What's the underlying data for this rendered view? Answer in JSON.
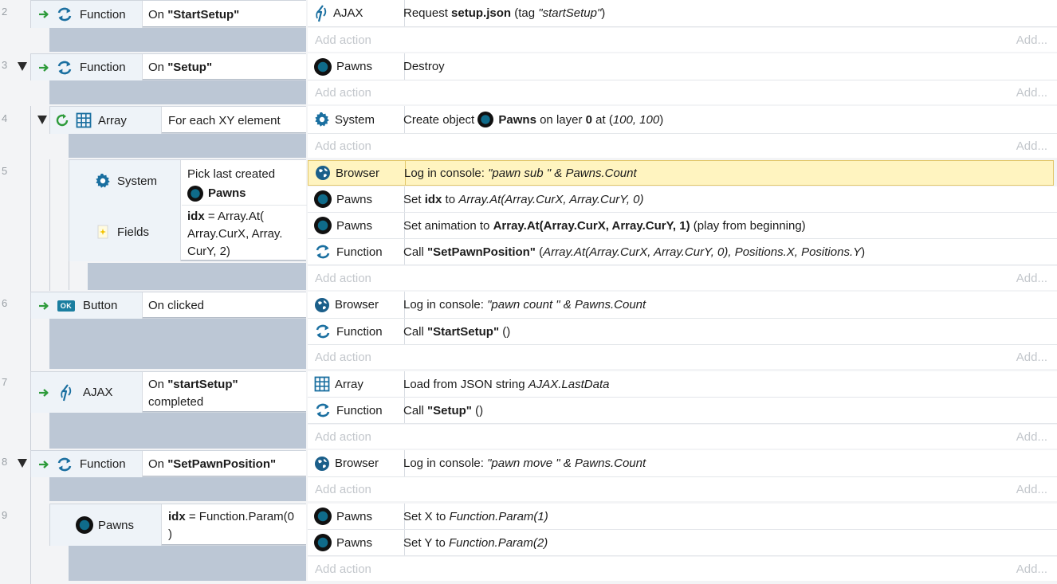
{
  "rows": {
    "r2": {
      "num": "2",
      "trigger_obj": "Function",
      "trigger_prefix": "On ",
      "trigger_name": "\"StartSetup\"",
      "actions": [
        {
          "obj": "AJAX",
          "pre": "Request ",
          "bold": "setup.json",
          "mid": " (tag ",
          "ital": "\"startSetup\"",
          "post": ")"
        }
      ]
    },
    "r3": {
      "num": "3",
      "trigger_obj": "Function",
      "trigger_prefix": "On ",
      "trigger_name": "\"Setup\"",
      "actions": [
        {
          "obj": "Pawns",
          "text": "Destroy"
        }
      ]
    },
    "r4": {
      "num": "4",
      "trigger_obj": "Array",
      "condition": "For each XY element",
      "actions": [
        {
          "obj": "System",
          "pre": "Create object ",
          "bold": "Pawns",
          "mid": " on layer ",
          "bold2": "0",
          "mid2": " at (",
          "ital": "100, 100",
          "post": ")"
        }
      ]
    },
    "r5": {
      "num": "5",
      "cond1_obj": "System",
      "cond1_line1": "Pick last created",
      "cond1_line2": "Pawns",
      "cond2_obj": "Fields",
      "cond2_bold": "idx",
      "cond2_l1": " = Array.At(",
      "cond2_l2": "Array.CurX, Array.",
      "cond2_l3": "CurY, 2)",
      "actions": [
        {
          "obj": "Browser",
          "pre": "Log in console: ",
          "ital": "\"pawn sub \" & Pawns.Count"
        },
        {
          "obj": "Pawns",
          "pre": "Set ",
          "bold": "idx",
          "mid": " to ",
          "ital": "Array.At(Array.CurX, Array.CurY, 0)"
        },
        {
          "obj": "Pawns",
          "pre": "Set animation to ",
          "bold": "Array.At(Array.CurX, Array.CurY, 1)",
          "post": " (play from beginning)"
        },
        {
          "obj": "Function",
          "pre": "Call ",
          "bold": "\"SetPawnPosition\"",
          "mid": " (",
          "ital": "Array.At(Array.CurX, Array.CurY, 0), Positions.X, Positions.Y",
          "post": ")"
        }
      ]
    },
    "r6": {
      "num": "6",
      "trigger_obj": "Button",
      "condition": "On clicked",
      "actions": [
        {
          "obj": "Browser",
          "pre": "Log in console: ",
          "ital": "\"pawn count \" & Pawns.Count"
        },
        {
          "obj": "Function",
          "pre": "Call ",
          "bold": "\"StartSetup\"",
          "post": " ()"
        }
      ]
    },
    "r7": {
      "num": "7",
      "trigger_obj": "AJAX",
      "trigger_prefix": "On ",
      "trigger_name": "\"startSetup\"",
      "trigger_line2": "completed",
      "actions": [
        {
          "obj": "Array",
          "pre": "Load from JSON string ",
          "ital": "AJAX.LastData"
        },
        {
          "obj": "Function",
          "pre": "Call ",
          "bold": "\"Setup\"",
          "post": " ()"
        }
      ]
    },
    "r8": {
      "num": "8",
      "trigger_obj": "Function",
      "trigger_prefix": "On ",
      "trigger_name": "\"SetPawnPosition\"",
      "actions": [
        {
          "obj": "Browser",
          "pre": "Log in console: ",
          "ital": "\"pawn move \" & Pawns.Count"
        }
      ]
    },
    "r9": {
      "num": "9",
      "cond_obj": "Pawns",
      "cond_bold": "idx",
      "cond_l1": " = Function.Param(0",
      "cond_l2": ")",
      "actions": [
        {
          "obj": "Pawns",
          "pre": "Set X to ",
          "ital": "Function.Param(1)"
        },
        {
          "obj": "Pawns",
          "pre": "Set Y to ",
          "ital": "Function.Param(2)"
        }
      ]
    }
  },
  "add_action_label": "Add action",
  "add_more_label": "Add...",
  "colors": {
    "highlight": "#fff4c0",
    "accent": "#1a7ea0",
    "filler": "#bcc7d5"
  }
}
